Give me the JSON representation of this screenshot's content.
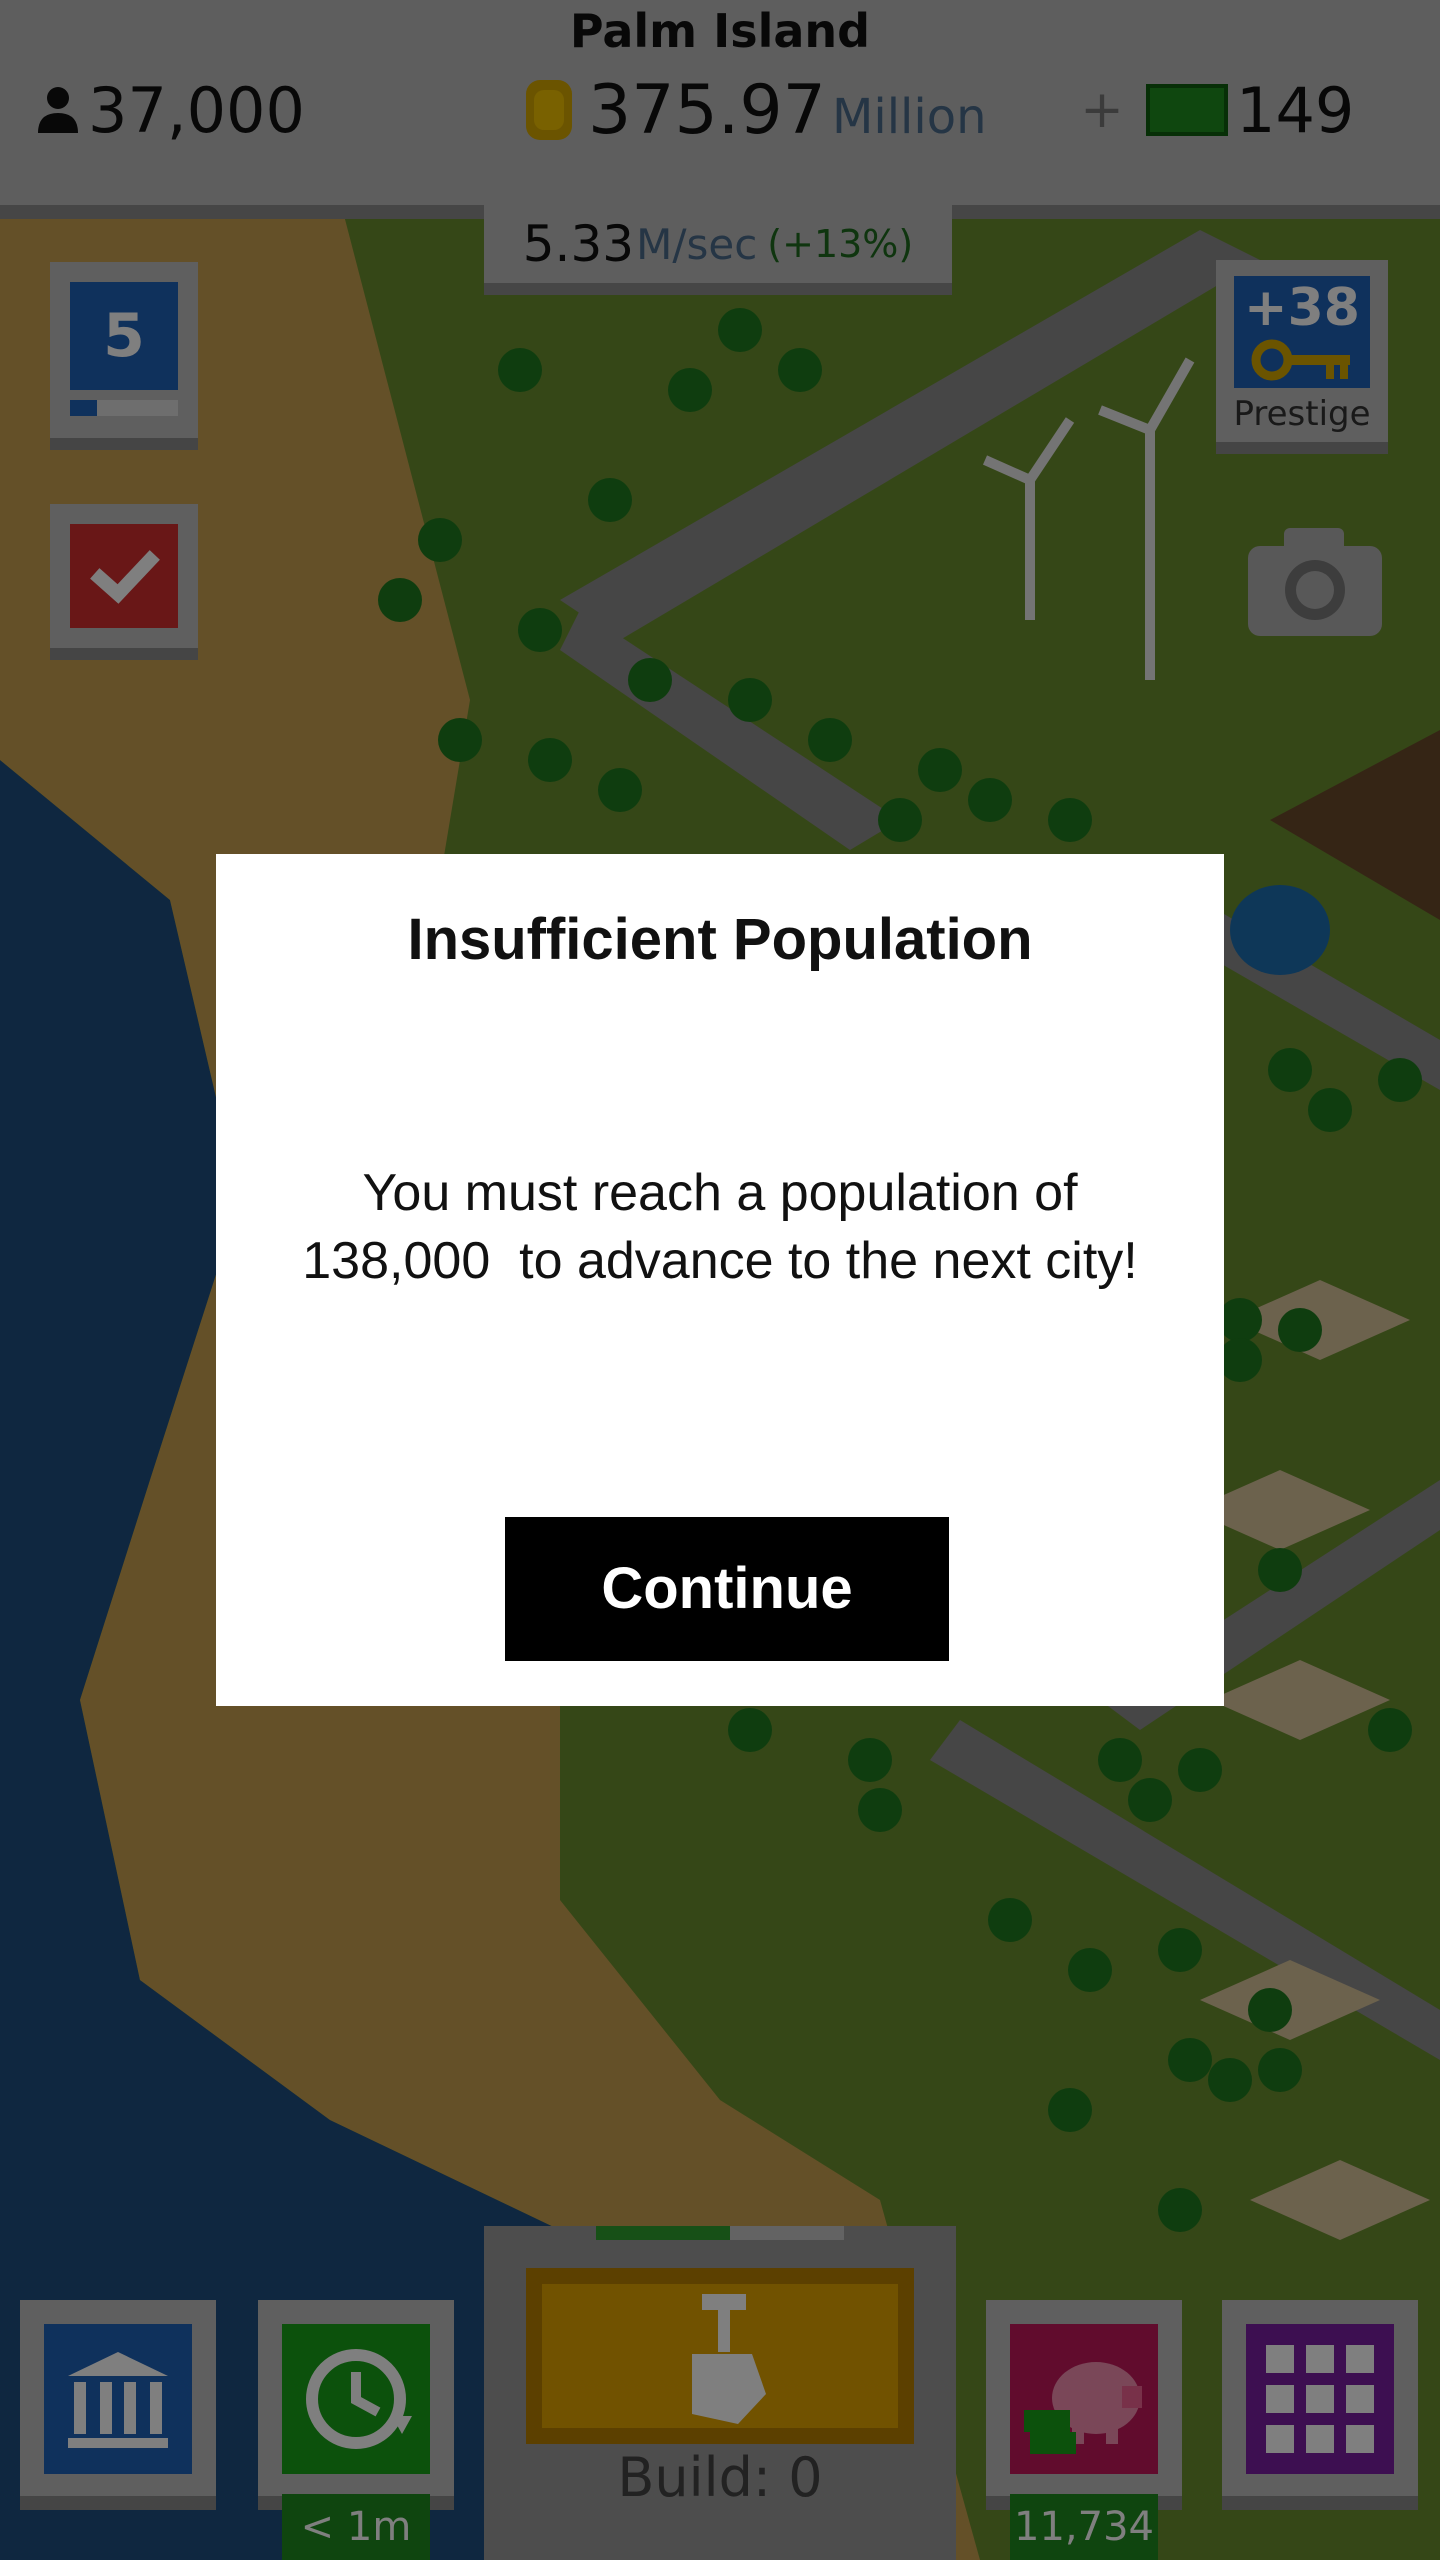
{
  "header": {
    "city_name": "Palm Island",
    "population": "37,000",
    "money_value": "375.97",
    "money_unit": "Million",
    "cash": "149",
    "income_rate_value": "5.33",
    "income_rate_unit": "M/sec",
    "income_rate_bonus": "(+13%)"
  },
  "side_buttons": {
    "level": "5",
    "level_progress": 0.25,
    "prestige_value": "+38",
    "prestige_label": "Prestige"
  },
  "bottom_bar": {
    "timer_label": "< 1m",
    "build_label": "Build: 0",
    "build_progress": 0.54,
    "bank_value": "11,734"
  },
  "dialog": {
    "title": "Insufficient Population",
    "message_line1": "You must reach a population of",
    "message_line2": "138,000  to advance to the next city!",
    "button_label": "Continue"
  },
  "colors": {
    "accent_blue": "#1f62b8",
    "alert_red": "#d32f2f",
    "money_green": "#1f8a1f",
    "menu_purple": "#7b1fa2",
    "bank_pink": "#c2185b",
    "build_yellow": "#e3a400"
  },
  "icons": [
    "person-icon",
    "coin-icon",
    "cash-icon",
    "check-icon",
    "key-icon",
    "camera-icon",
    "government-icon",
    "clock-icon",
    "hammer-hand-icon",
    "piggy-bank-icon",
    "grid-menu-icon"
  ]
}
